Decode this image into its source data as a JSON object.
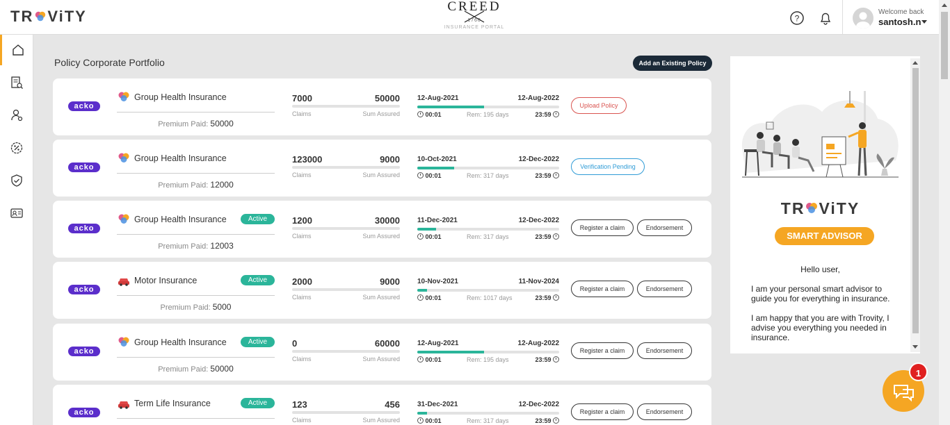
{
  "header": {
    "logo_text": "TR ViTY",
    "brand_name": "CREED",
    "brand_year": "1760",
    "brand_sub": "INSURANCE PORTAL",
    "welcome": "Welcome back",
    "username": "santosh.n"
  },
  "sidebar": {
    "items": [
      {
        "icon": "home-icon",
        "active": true
      },
      {
        "icon": "policy-document-icon"
      },
      {
        "icon": "user-settings-icon"
      },
      {
        "icon": "discount-icon"
      },
      {
        "icon": "shield-check-icon"
      },
      {
        "icon": "id-card-icon"
      }
    ]
  },
  "main": {
    "title": "Policy Corporate Portfolio",
    "add_button": "Add an Existing Policy",
    "premium_label": "Premium Paid:",
    "claims_label": "Claims",
    "sum_label": "Sum Assured",
    "policies": [
      {
        "insurer": "acko",
        "name": "Group Health Insurance",
        "status": "",
        "premium": "50000",
        "claims": "7000",
        "sum": "50000",
        "start": "12-Aug-2021",
        "end": "12-Aug-2022",
        "start_time": "00:01",
        "end_time": "23:59",
        "remaining": "Rem: 195 days",
        "progress": 0.47,
        "claims_progress": 0.0,
        "actions": [
          "Upload Policy"
        ]
      },
      {
        "insurer": "acko",
        "name": "Group Health Insurance",
        "status": "",
        "premium": "12000",
        "claims": "123000",
        "sum": "9000",
        "start": "10-Oct-2021",
        "end": "12-Dec-2022",
        "start_time": "00:01",
        "end_time": "23:59",
        "remaining": "Rem: 317 days",
        "progress": 0.26,
        "claims_progress": 0.0,
        "actions": [
          "Verification Pending"
        ]
      },
      {
        "insurer": "acko",
        "name": "Group Health Insurance",
        "status": "Active",
        "premium": "12003",
        "claims": "1200",
        "sum": "30000",
        "start": "11-Dec-2021",
        "end": "12-Dec-2022",
        "start_time": "00:01",
        "end_time": "23:59",
        "remaining": "Rem: 317 days",
        "progress": 0.13,
        "claims_progress": 0.0,
        "actions": [
          "Register a claim",
          "Endorsement"
        ]
      },
      {
        "insurer": "acko",
        "name": "Motor Insurance",
        "status": "Active",
        "premium": "5000",
        "claims": "2000",
        "sum": "9000",
        "start": "10-Nov-2021",
        "end": "11-Nov-2024",
        "start_time": "00:01",
        "end_time": "23:59",
        "remaining": "Rem: 1017 days",
        "progress": 0.07,
        "claims_progress": 0.0,
        "actions": [
          "Register a claim",
          "Endorsement"
        ]
      },
      {
        "insurer": "acko",
        "name": "Group Health Insurance",
        "status": "Active",
        "premium": "50000",
        "claims": "0",
        "sum": "60000",
        "start": "12-Aug-2021",
        "end": "12-Aug-2022",
        "start_time": "00:01",
        "end_time": "23:59",
        "remaining": "Rem: 195 days",
        "progress": 0.47,
        "claims_progress": 0.0,
        "actions": [
          "Register a claim",
          "Endorsement"
        ]
      },
      {
        "insurer": "acko",
        "name": "Term Life Insurance",
        "status": "Active",
        "premium": "",
        "claims": "123",
        "sum": "456",
        "start": "31-Dec-2021",
        "end": "12-Dec-2022",
        "start_time": "00:01",
        "end_time": "23:59",
        "remaining": "Rem: 317 days",
        "progress": 0.07,
        "claims_progress": 0.0,
        "actions": [
          "Register a claim",
          "Endorsement"
        ]
      }
    ]
  },
  "advisor": {
    "logo_text": "TR ViTY",
    "badge": "SMART ADVISOR",
    "hello": "Hello user,",
    "para1": "I am your personal smart advisor to guide you for everything in insurance.",
    "para2": "I am happy that you are with Trovity, I advise you everything you needed in insurance."
  },
  "chat": {
    "count": "1"
  },
  "colors": {
    "accent": "#f5a623",
    "success": "#2bb59a",
    "danger": "#d9534f",
    "info": "#2f9bd6",
    "dark": "#1b2a38"
  }
}
